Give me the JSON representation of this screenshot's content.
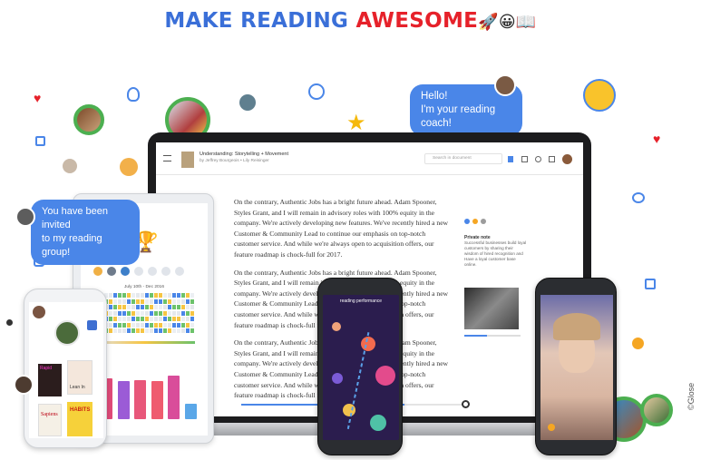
{
  "headline": {
    "part1": "MAKE READING ",
    "part2": "AWESOME",
    "emojis": "🚀😀📖"
  },
  "bubbles": {
    "coach_line1": "Hello!",
    "coach_line2": "I'm your reading coach!",
    "invite_line1": "You have been invited",
    "invite_line2": "to my reading group!"
  },
  "laptop": {
    "doc_title": "Understanding: Storytelling + Movement",
    "doc_author": "by Jeffrey Bourgeois • Lily Reisinger",
    "search_placeholder": "Search in document",
    "paragraphs": [
      "On the contrary, Authentic Jobs has a bright future ahead. Adam Spooner, Styles Grant, and I will remain in advisory roles with 100% equity in the company. We're actively developing new features. We've recently hired a new Customer & Community Lead to continue our emphasis on top-notch customer service. And while we're always open to acquisition offers, our feature roadmap is chock-full for 2017.",
      "On the contrary, Authentic Jobs has a bright future ahead. Adam Spooner, Styles Grant, and I will remain in advisory roles with 100% equity in the company. We're actively developing new features. We've recently hired a new Customer & Community Lead to continue our emphasis on top-notch customer service. And while we're always open to acquisition offers, our feature roadmap is chock-full for 2017.",
      "On the contrary, Authentic Jobs has a bright future ahead. Adam Spooner, Styles Grant, and I will remain in advisory roles with 100% equity in the company. We're actively developing new features. We've recently hired a new Customer & Community Lead to continue our emphasis on top-notch customer service. And while we're always open to acquisition offers, our feature roadmap is chock-full for 2017."
    ],
    "side_note_title": "Private note",
    "side_note_text": "Successful businesses build loyal customers by sharing their wisdom of hired recognition and Have a loyal customer base online.",
    "progress": 0.72
  },
  "tablet": {
    "chart_title": "July 10th - Dec 2016",
    "chart_data": {
      "type": "bar",
      "categories": [
        "",
        "",
        "",
        "",
        "",
        ""
      ],
      "values": [
        0.45,
        0.42,
        0.43,
        0.42,
        0.48,
        0.17
      ]
    },
    "bar_colors": [
      "#e04b7a",
      "#9b5bd6",
      "#e8577a",
      "#ef5b6f",
      "#d94d9a",
      "#5aa7e8"
    ]
  },
  "phone_left": {
    "book1_title": "Rapid",
    "book2_title": "Lean In",
    "book3_title": "Sapiens",
    "book4_title": "HABITS"
  },
  "phone_mid": {
    "title": "reading performance"
  },
  "credit": "©Glose",
  "colors": {
    "accent_blue": "#4a86e8",
    "headline_red": "#e6212a",
    "ring_green": "#4caf50"
  }
}
